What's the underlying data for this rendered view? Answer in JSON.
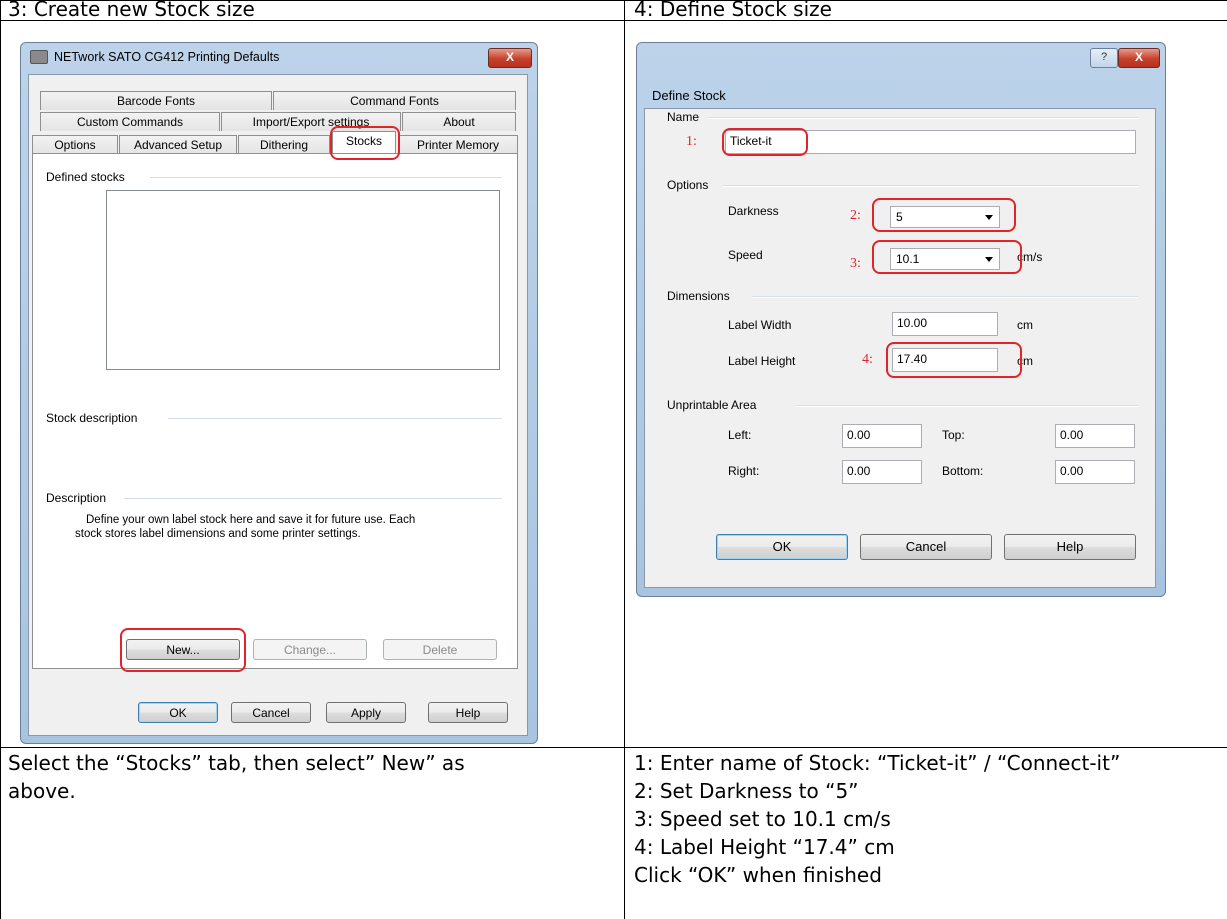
{
  "left_header": "3:  Create new Stock size",
  "right_header": "4:  Define Stock size",
  "left_instructions": [
    "Select the “Stocks” tab, then select” New” as",
    "above."
  ],
  "right_instructions": [
    "1:  Enter name of Stock: “Ticket-it” / “Connect-it”",
    "2:  Set Darkness to “5”",
    "3:  Speed set to 10.1 cm/s",
    "4:  Label Height “17.4” cm",
    "Click “OK” when finished"
  ],
  "dialog1": {
    "title": "NETwork SATO CG412 Printing Defaults",
    "close_label": "X",
    "tabs": {
      "barcode_fonts": "Barcode Fonts",
      "command_fonts": "Command Fonts",
      "custom_commands": "Custom Commands",
      "import_export": "Import/Export settings",
      "about": "About",
      "options": "Options",
      "advanced_setup": "Advanced Setup",
      "dithering": "Dithering",
      "stocks": "Stocks",
      "printer_memory": "Printer Memory"
    },
    "defined_stocks_label": "Defined stocks",
    "stock_description_label": "Stock description",
    "description_label": "Description",
    "description_text_1": "Define your own label stock here and save it for future use. Each",
    "description_text_2": "stock stores label dimensions and some printer settings.",
    "new_button": "New...",
    "change_button": "Change...",
    "delete_button": "Delete",
    "ok_button": "OK",
    "cancel_button": "Cancel",
    "apply_button": "Apply",
    "help_button": "Help"
  },
  "dialog2": {
    "title": "Define Stock",
    "help_label": "?",
    "close_label": "X",
    "name_group": "Name",
    "name_value": "Ticket-it",
    "options_group": "Options",
    "darkness_label": "Darkness",
    "darkness_value": "5",
    "speed_label": "Speed",
    "speed_value": "10.1",
    "speed_unit": "cm/s",
    "dimensions_group": "Dimensions",
    "label_width_label": "Label Width",
    "label_width_value": "10.00",
    "label_width_unit": "cm",
    "label_height_label": "Label Height",
    "label_height_value": "17.40",
    "label_height_unit": "cm",
    "unprintable_group": "Unprintable Area",
    "left_label": "Left:",
    "left_value": "0.00",
    "top_label": "Top:",
    "top_value": "0.00",
    "right_label": "Right:",
    "right_value": "0.00",
    "bottom_label": "Bottom:",
    "bottom_value": "0.00",
    "ok_button": "OK",
    "cancel_button": "Cancel",
    "help_button": "Help",
    "markers": [
      "1:",
      "2:",
      "3:",
      "4:"
    ]
  }
}
